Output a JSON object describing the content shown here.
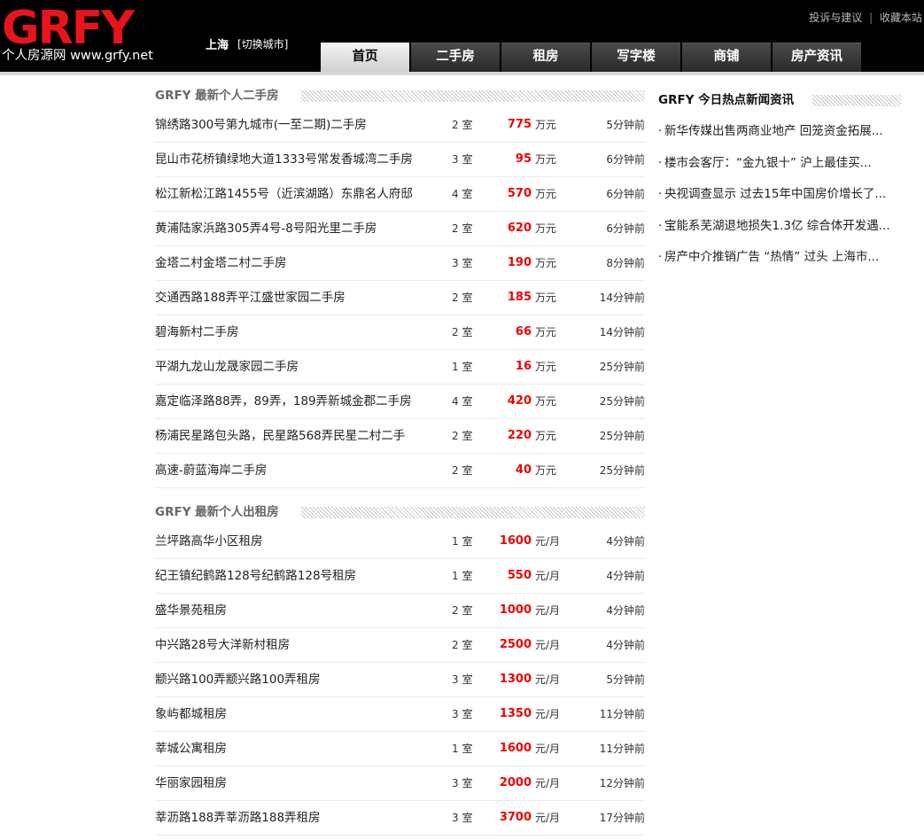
{
  "header": {
    "logo_mark": "GRFY",
    "logo_sub": "个人房源网 www.grfy.net",
    "city": "上海",
    "city_switch": "[切换城市]",
    "toplinks": [
      "投诉与建议",
      "收藏本站"
    ],
    "toplink_sep": "|"
  },
  "nav": {
    "tabs": [
      {
        "label": "首页",
        "active": true
      },
      {
        "label": "二手房"
      },
      {
        "label": "租房"
      },
      {
        "label": "写字楼"
      },
      {
        "label": "商铺"
      },
      {
        "label": "房产资讯"
      }
    ]
  },
  "sale": {
    "title": "GRFY 最新个人二手房",
    "items": [
      {
        "title": "锦绣路300号第九城市(一至二期)二手房",
        "rooms": "2 室",
        "price": "775",
        "unit": "万元",
        "time": "5分钟前"
      },
      {
        "title": "昆山市花桥镇绿地大道1333号常发香城湾二手房",
        "rooms": "3 室",
        "price": "95",
        "unit": "万元",
        "time": "6分钟前"
      },
      {
        "title": "松江新松江路1455号（近滨湖路）东鼎名人府邸",
        "rooms": "4 室",
        "price": "570",
        "unit": "万元",
        "time": "6分钟前"
      },
      {
        "title": "黄浦陆家浜路305弄4号-8号阳光里二手房",
        "rooms": "2 室",
        "price": "620",
        "unit": "万元",
        "time": "6分钟前"
      },
      {
        "title": "金塔二村金塔二村二手房",
        "rooms": "3 室",
        "price": "190",
        "unit": "万元",
        "time": "8分钟前"
      },
      {
        "title": "交通西路188弄平江盛世家园二手房",
        "rooms": "2 室",
        "price": "185",
        "unit": "万元",
        "time": "14分钟前"
      },
      {
        "title": "碧海新村二手房",
        "rooms": "2 室",
        "price": "66",
        "unit": "万元",
        "time": "14分钟前"
      },
      {
        "title": "平湖九龙山龙晟家园二手房",
        "rooms": "1 室",
        "price": "16",
        "unit": "万元",
        "time": "25分钟前"
      },
      {
        "title": "嘉定临泽路88弄，89弄，189弄新城金郡二手房",
        "rooms": "4 室",
        "price": "420",
        "unit": "万元",
        "time": "25分钟前"
      },
      {
        "title": "杨浦民星路包头路，民星路568弄民星二村二手",
        "rooms": "2 室",
        "price": "220",
        "unit": "万元",
        "time": "25分钟前"
      },
      {
        "title": "高速-蔚蓝海岸二手房",
        "rooms": "2 室",
        "price": "40",
        "unit": "万元",
        "time": "25分钟前"
      }
    ]
  },
  "rent": {
    "title": "GRFY 最新个人出租房",
    "items": [
      {
        "title": "兰坪路高华小区租房",
        "rooms": "1 室",
        "price": "1600",
        "unit": "元/月",
        "time": "4分钟前"
      },
      {
        "title": "纪王镇纪鹤路128号纪鹤路128号租房",
        "rooms": "1 室",
        "price": "550",
        "unit": "元/月",
        "time": "4分钟前"
      },
      {
        "title": "盛华景苑租房",
        "rooms": "2 室",
        "price": "1000",
        "unit": "元/月",
        "time": "4分钟前"
      },
      {
        "title": "中兴路28号大洋新村租房",
        "rooms": "2 室",
        "price": "2500",
        "unit": "元/月",
        "time": "4分钟前"
      },
      {
        "title": "颛兴路100弄颛兴路100弄租房",
        "rooms": "3 室",
        "price": "1300",
        "unit": "元/月",
        "time": "5分钟前"
      },
      {
        "title": "象屿都城租房",
        "rooms": "3 室",
        "price": "1350",
        "unit": "元/月",
        "time": "11分钟前"
      },
      {
        "title": "莘城公寓租房",
        "rooms": "1 室",
        "price": "1600",
        "unit": "元/月",
        "time": "11分钟前"
      },
      {
        "title": "华丽家园租房",
        "rooms": "3 室",
        "price": "2000",
        "unit": "元/月",
        "time": "12分钟前"
      },
      {
        "title": "莘沥路188弄莘沥路188弄租房",
        "rooms": "3 室",
        "price": "3700",
        "unit": "元/月",
        "time": "17分钟前"
      }
    ]
  },
  "news": {
    "title": "GRFY 今日热点新闻资讯",
    "bullet": "·",
    "items": [
      "新华传媒出售两商业地产  回笼资金拓展...",
      "楼市会客厅：“金九银十” 沪上最佳买...",
      "央视调查显示  过去15年中国房价增长了...",
      "宝能系芜湖退地损失1.3亿  综合体开发遇...",
      "房产中介推销广告 “热情” 过头  上海市..."
    ]
  },
  "colors": {
    "accent": "#e8141b",
    "price": "#ee0000",
    "header_bg": "#000000"
  }
}
